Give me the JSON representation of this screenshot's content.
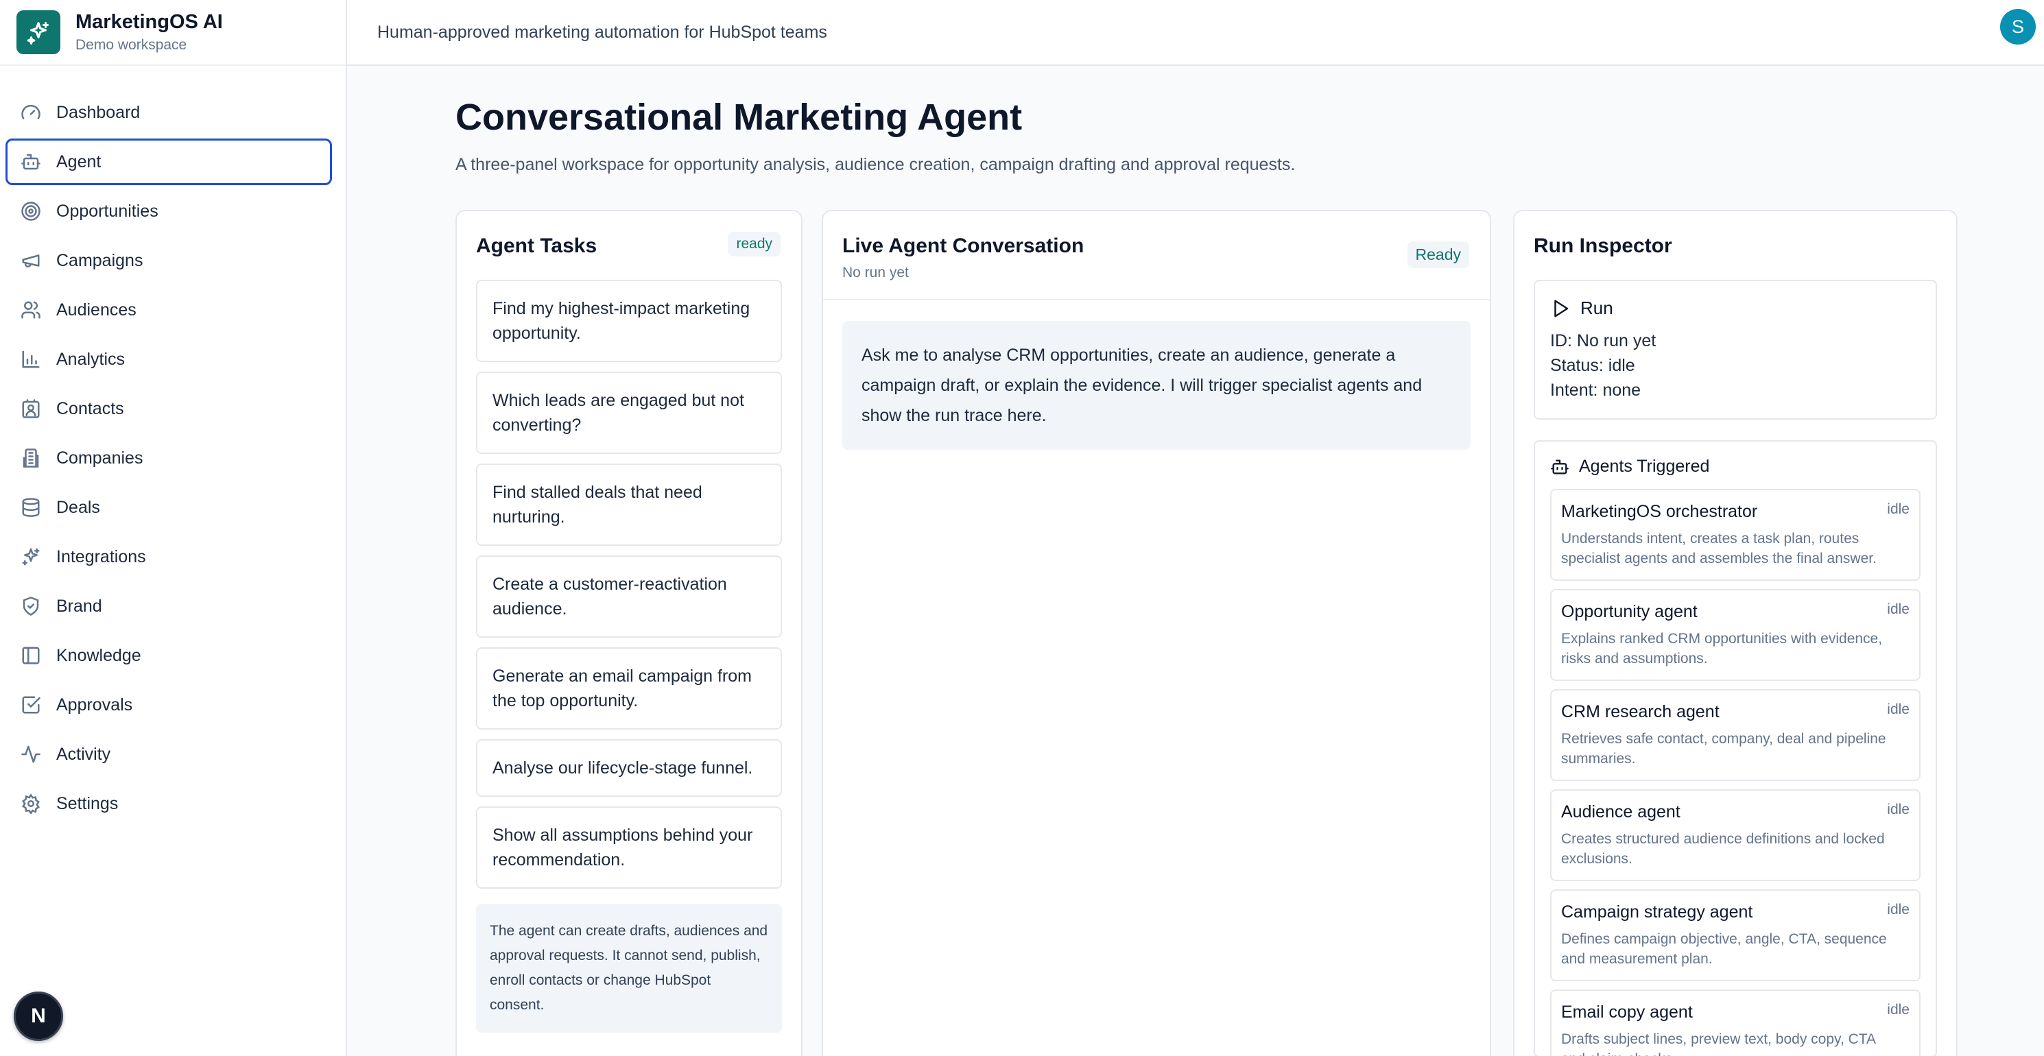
{
  "app": {
    "name": "MarketingOS AI",
    "workspace": "Demo workspace",
    "tagline": "Human-approved marketing automation for HubSpot teams",
    "user_initial": "S",
    "dev_badge": "N"
  },
  "sidebar": {
    "items": [
      {
        "label": "Dashboard",
        "icon": "gauge-icon"
      },
      {
        "label": "Agent",
        "icon": "bot-icon",
        "active": true
      },
      {
        "label": "Opportunities",
        "icon": "target-icon"
      },
      {
        "label": "Campaigns",
        "icon": "megaphone-icon"
      },
      {
        "label": "Audiences",
        "icon": "users-icon"
      },
      {
        "label": "Analytics",
        "icon": "bar-chart-icon"
      },
      {
        "label": "Contacts",
        "icon": "contact-icon"
      },
      {
        "label": "Companies",
        "icon": "building-icon"
      },
      {
        "label": "Deals",
        "icon": "database-icon"
      },
      {
        "label": "Integrations",
        "icon": "sparkles-icon"
      },
      {
        "label": "Brand",
        "icon": "shield-icon"
      },
      {
        "label": "Knowledge",
        "icon": "book-icon"
      },
      {
        "label": "Approvals",
        "icon": "check-square-icon"
      },
      {
        "label": "Activity",
        "icon": "activity-icon"
      },
      {
        "label": "Settings",
        "icon": "gear-icon"
      }
    ]
  },
  "page": {
    "title": "Conversational Marketing Agent",
    "subtitle": "A three-panel workspace for opportunity analysis, audience creation, campaign drafting and approval requests."
  },
  "tasks": {
    "title": "Agent Tasks",
    "status": "ready",
    "items": [
      "Find my highest-impact marketing opportunity.",
      "Which leads are engaged but not converting?",
      "Find stalled deals that need nurturing.",
      "Create a customer-reactivation audience.",
      "Generate an email campaign from the top opportunity.",
      "Analyse our lifecycle-stage funnel.",
      "Show all assumptions behind your recommendation."
    ],
    "note": "The agent can create drafts, audiences and approval requests. It cannot send, publish, enroll contacts or change HubSpot consent."
  },
  "conversation": {
    "title": "Live Agent Conversation",
    "run_label": "No run yet",
    "status": "Ready",
    "message": "Ask me to analyse CRM opportunities, create an audience, generate a campaign draft, or explain the evidence. I will trigger specialist agents and show the run trace here."
  },
  "inspector": {
    "title": "Run Inspector",
    "run": {
      "label": "Run",
      "id_line": "ID: No run yet",
      "status_line": "Status: idle",
      "intent_line": "Intent: none"
    },
    "agents_title": "Agents Triggered",
    "agents": [
      {
        "name": "MarketingOS orchestrator",
        "state": "idle",
        "desc": "Understands intent, creates a task plan, routes specialist agents and assembles the final answer."
      },
      {
        "name": "Opportunity agent",
        "state": "idle",
        "desc": "Explains ranked CRM opportunities with evidence, risks and assumptions."
      },
      {
        "name": "CRM research agent",
        "state": "idle",
        "desc": "Retrieves safe contact, company, deal and pipeline summaries."
      },
      {
        "name": "Audience agent",
        "state": "idle",
        "desc": "Creates structured audience definitions and locked exclusions."
      },
      {
        "name": "Campaign strategy agent",
        "state": "idle",
        "desc": "Defines campaign objective, angle, CTA, sequence and measurement plan."
      },
      {
        "name": "Email copy agent",
        "state": "idle",
        "desc": "Drafts subject lines, preview text, body copy, CTA and claim-checks."
      }
    ]
  },
  "colors": {
    "brand": "#0f766e",
    "active_border": "#1d4ed8",
    "avatar": "#0891b2"
  }
}
